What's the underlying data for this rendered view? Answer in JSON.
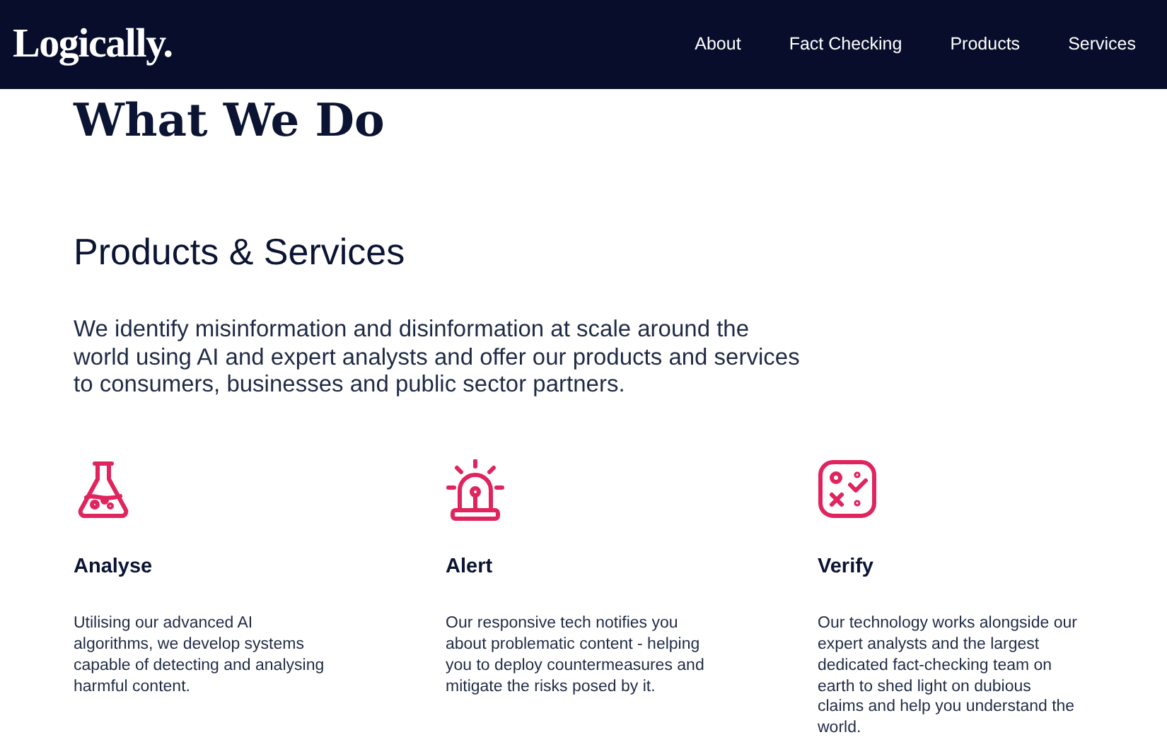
{
  "header": {
    "logo": "Logically.",
    "nav": [
      {
        "label": "About"
      },
      {
        "label": "Fact Checking"
      },
      {
        "label": "Products"
      },
      {
        "label": "Services"
      }
    ]
  },
  "page_title": "What We Do",
  "section_title": "Products & Services",
  "intro": "We identify misinformation and disinformation at scale around the world using AI and expert analysts and offer our products and services to consumers, businesses and public sector partners.",
  "features": [
    {
      "kind": "flask",
      "title": "Analyse",
      "text": "Utilising our advanced AI algorithms, we develop systems capable of detecting and analysing harmful content."
    },
    {
      "kind": "siren",
      "title": "Alert",
      "text": "Our responsive tech notifies you about problematic content - helping you to deploy countermeasures and mitigate the risks posed by it."
    },
    {
      "kind": "checklist",
      "title": "Verify",
      "text": "Our technology works alongside our expert analysts and the largest dedicated fact-checking team on earth to shed light on dubious claims and help you understand the world."
    }
  ]
}
